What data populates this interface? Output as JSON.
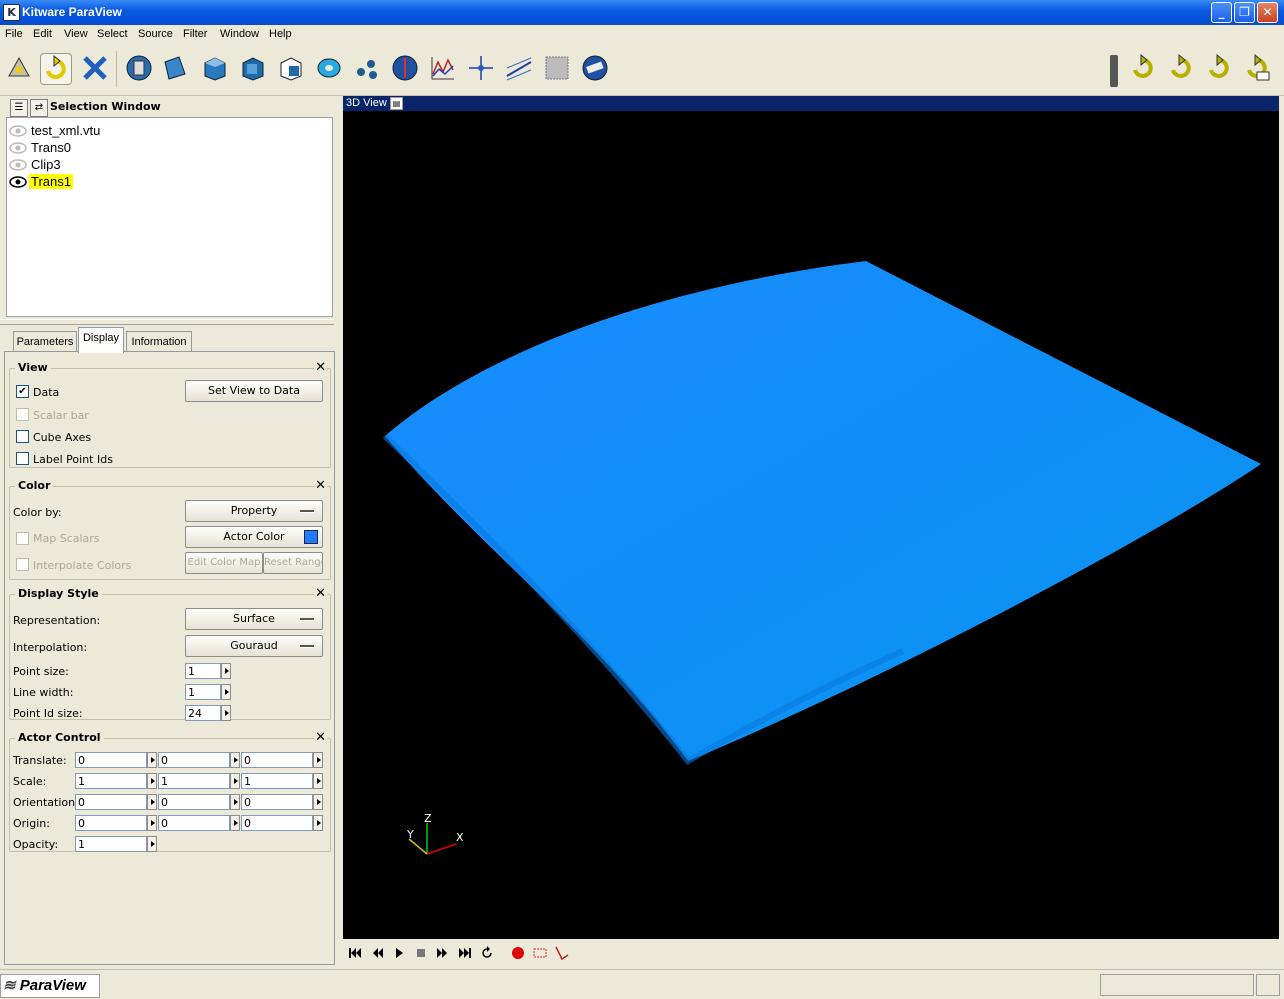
{
  "window": {
    "title": "Kitware ParaView"
  },
  "menu": [
    "File",
    "Edit",
    "View",
    "Select",
    "Source",
    "Filter",
    "Window",
    "Help"
  ],
  "selection_window": {
    "title": "Selection Window",
    "items": [
      {
        "label": "test_xml.vtu",
        "visible": false
      },
      {
        "label": "Trans0",
        "visible": false
      },
      {
        "label": "Clip3",
        "visible": false
      },
      {
        "label": "Trans1",
        "visible": true,
        "selected": true
      }
    ]
  },
  "tabs": [
    {
      "label": "Parameters"
    },
    {
      "label": "Display",
      "active": true
    },
    {
      "label": "Information"
    }
  ],
  "view_group": {
    "title": "View",
    "data_label": "Data",
    "data_checked": true,
    "scalar_bar_label": "Scalar bar",
    "cube_axes_label": "Cube Axes",
    "label_point_ids_label": "Label Point Ids",
    "set_view_button": "Set View to Data"
  },
  "color_group": {
    "title": "Color",
    "color_by_label": "Color by:",
    "color_by_value": "Property",
    "map_scalars_label": "Map Scalars",
    "actor_color_label": "Actor Color",
    "actor_color": "#1e7cff",
    "interpolate_colors_label": "Interpolate Colors",
    "edit_color_map_button": "Edit Color Map",
    "reset_range_button": "Reset Range"
  },
  "display_style_group": {
    "title": "Display Style",
    "representation_label": "Representation:",
    "representation_value": "Surface",
    "interpolation_label": "Interpolation:",
    "interpolation_value": "Gouraud",
    "point_size_label": "Point size:",
    "point_size_value": "1",
    "line_width_label": "Line width:",
    "line_width_value": "1",
    "point_id_size_label": "Point Id size:",
    "point_id_size_value": "24"
  },
  "actor_control_group": {
    "title": "Actor Control",
    "translate_label": "Translate:",
    "translate": [
      "0",
      "0",
      "0"
    ],
    "scale_label": "Scale:",
    "scale": [
      "1",
      "1",
      "1"
    ],
    "orientation_label": "Orientation:",
    "orientation": [
      "0",
      "0",
      "0"
    ],
    "origin_label": "Origin:",
    "origin": [
      "0",
      "0",
      "0"
    ],
    "opacity_label": "Opacity:",
    "opacity": "1"
  },
  "view3d": {
    "title": "3D View",
    "surface_color": "#1e90ff",
    "axes_labels": {
      "z": "Z",
      "y": "Y",
      "x": "X"
    }
  },
  "status": {
    "logo": "ParaView"
  },
  "colors": {
    "titlebar": "#0a5ae0",
    "selection_highlight": "#ffff00",
    "view_title_bg": "#0a246a"
  }
}
